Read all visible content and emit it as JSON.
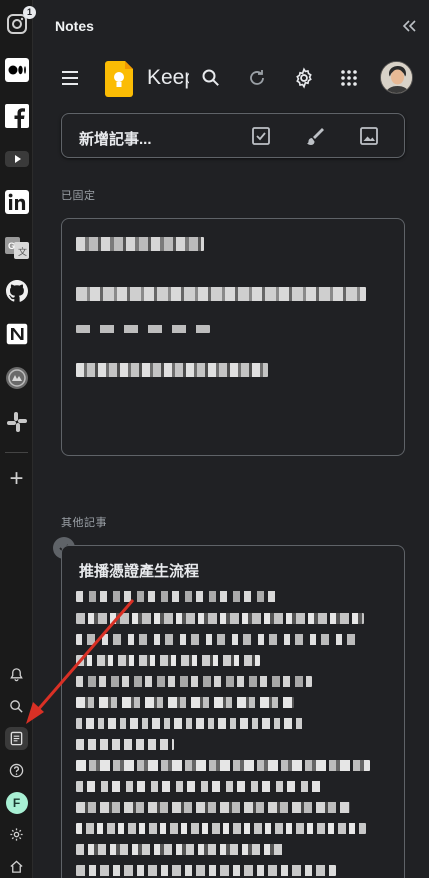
{
  "dock": {
    "apps": [
      {
        "name": "instagram-icon",
        "badge": "1"
      },
      {
        "name": "medium-icon"
      },
      {
        "name": "facebook-icon"
      },
      {
        "name": "youtube-icon"
      },
      {
        "name": "linkedin-icon"
      },
      {
        "name": "google-translate-icon"
      },
      {
        "name": "github-icon"
      },
      {
        "name": "notion-icon"
      },
      {
        "name": "emblem-icon"
      },
      {
        "name": "slack-icon"
      }
    ],
    "add_label": "+",
    "utilities": [
      "bell-icon",
      "search-icon",
      "notes-icon",
      "help-icon",
      "profile-avatar",
      "settings-icon",
      "home-icon"
    ],
    "avatar_letter": "F",
    "active_utility": "notes-icon"
  },
  "panel": {
    "title": "Notes"
  },
  "keep": {
    "app_name": "Keep",
    "logo_color": "#fbbc04"
  },
  "new_note": {
    "placeholder": "新增記事..."
  },
  "sections": {
    "pinned": "已固定",
    "others": "其他記事"
  },
  "notes": [
    {
      "title": "",
      "pinned": true
    },
    {
      "title": "推播憑證產生流程",
      "pinned": false
    }
  ],
  "colors": {
    "background": "#202124",
    "border": "#5f6368",
    "text": "#e8eaed",
    "muted": "#9aa0a6"
  }
}
